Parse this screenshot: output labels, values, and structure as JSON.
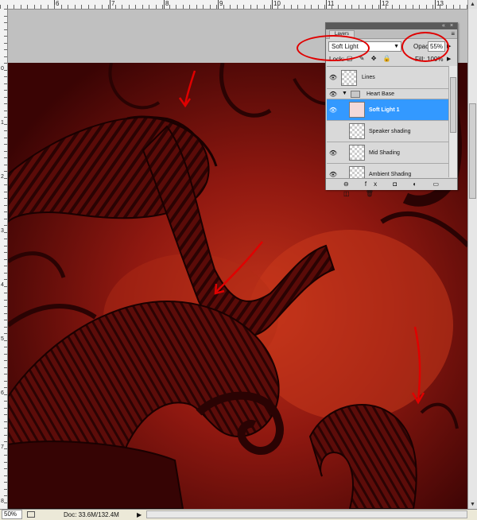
{
  "rulers": {
    "top_labels": [
      "6",
      "7",
      "8",
      "9",
      "10",
      "11",
      "12",
      "13"
    ],
    "left_labels": [
      "0",
      "1",
      "2",
      "3",
      "4",
      "5",
      "6",
      "7",
      "8"
    ]
  },
  "layers_panel": {
    "tab_label": "Layers",
    "blend_mode": "Soft Light",
    "opacity_label": "Opacity:",
    "opacity_value": "55%",
    "lock_label": "Lock:",
    "lock_icons": "▢ ✎ ✥ 🔒",
    "fill_label": "Fill:",
    "fill_value": "100%",
    "layers": [
      {
        "name": "Lines",
        "type": "layer",
        "visible": true,
        "selected": false
      },
      {
        "name": "Heart Base",
        "type": "group",
        "visible": true,
        "selected": false
      },
      {
        "name": "Soft Light 1",
        "type": "layer",
        "visible": true,
        "selected": true
      },
      {
        "name": "Speaker shading",
        "type": "layer",
        "visible": false,
        "selected": false
      },
      {
        "name": "Mid Shading",
        "type": "layer",
        "visible": true,
        "selected": false
      },
      {
        "name": "Ambient Shading",
        "type": "layer",
        "visible": true,
        "selected": false
      }
    ],
    "footer_icons": "⊖ fx ◘ ◐ ▭ ◫ 🗑"
  },
  "status_bar": {
    "zoom": "50%",
    "doc_info": "Doc: 33.6M/132.4M"
  },
  "colors": {
    "selection_blue": "#3399ff",
    "annotation_red": "#e00000",
    "canvas_dark_red": "#4a0606"
  }
}
